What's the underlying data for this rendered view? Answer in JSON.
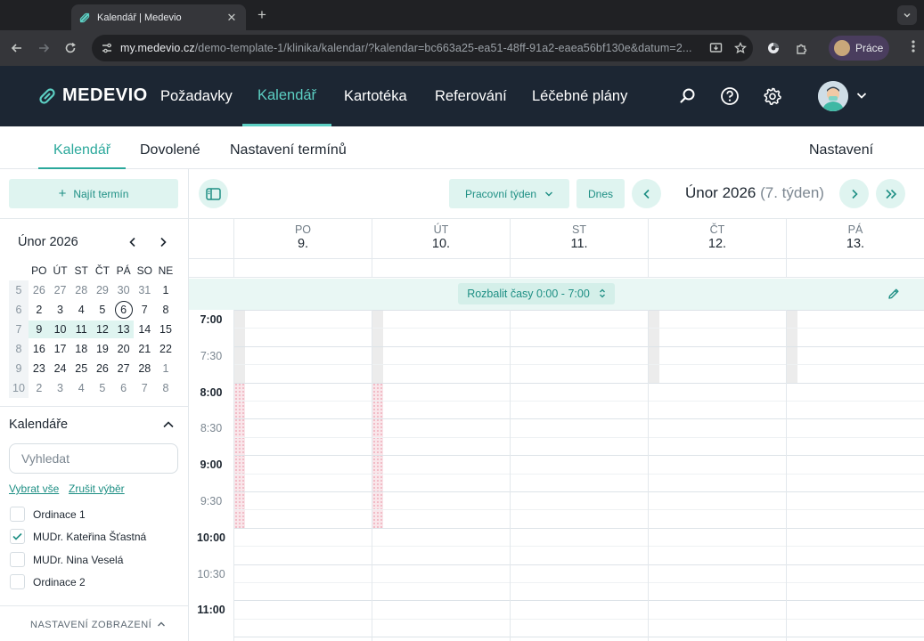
{
  "browser": {
    "tab_title": "Kalendář | Medevio",
    "url_host": "my.medevio.cz",
    "url_rest": "/demo-template-1/klinika/kalendar/?kalendar=bc663a25-ea51-48ff-91a2-eaea56bf130e&datum=2...",
    "profile_label": "Práce"
  },
  "app": {
    "logo_text": "MEDEVIO",
    "nav": [
      "Požadavky",
      "Kalendář",
      "Kartotéka",
      "Referování",
      "Léčebné plány"
    ],
    "active_nav": "Kalendář",
    "accent_color": "#5ccfc3",
    "header_bg": "#1c2633"
  },
  "subnav": {
    "tabs": [
      "Kalendář",
      "Dovolené",
      "Nastavení termínů"
    ],
    "settings": "Nastavení"
  },
  "sidebar": {
    "find_button": "Najít termín",
    "mini_calendar": {
      "title": "Únor 2026",
      "weekdays": [
        "PO",
        "ÚT",
        "ST",
        "ČT",
        "PÁ",
        "SO",
        "NE"
      ],
      "weeks": [
        {
          "wk": "5",
          "days": [
            "26",
            "27",
            "28",
            "29",
            "30",
            "31",
            "1"
          ]
        },
        {
          "wk": "6",
          "days": [
            "2",
            "3",
            "4",
            "5",
            "6",
            "7",
            "8"
          ]
        },
        {
          "wk": "7",
          "days": [
            "9",
            "10",
            "11",
            "12",
            "13",
            "14",
            "15"
          ]
        },
        {
          "wk": "8",
          "days": [
            "16",
            "17",
            "18",
            "19",
            "20",
            "21",
            "22"
          ]
        },
        {
          "wk": "9",
          "days": [
            "23",
            "24",
            "25",
            "26",
            "27",
            "28",
            "1"
          ]
        },
        {
          "wk": "10",
          "days": [
            "2",
            "3",
            "4",
            "5",
            "6",
            "7",
            "8"
          ]
        }
      ],
      "today": "6",
      "selected_week": "7"
    },
    "calendars_title": "Kalendáře",
    "search_placeholder": "Vyhledat",
    "select_all": "Vybrat vše",
    "clear_selection": "Zrušit výběr",
    "calendars": [
      {
        "label": "Ordinace 1",
        "checked": false
      },
      {
        "label": "MUDr. Kateřina Šťastná",
        "checked": true
      },
      {
        "label": "MUDr. Nina Veselá",
        "checked": false
      },
      {
        "label": "Ordinace 2",
        "checked": false
      }
    ],
    "display_settings": "NASTAVENÍ ZOBRAZENÍ"
  },
  "calendar": {
    "view_select": "Pracovní týden",
    "today_button": "Dnes",
    "month": "Únor 2026",
    "week": "(7. týden)",
    "days": [
      {
        "name": "PO",
        "date": "9."
      },
      {
        "name": "ÚT",
        "date": "10."
      },
      {
        "name": "ST",
        "date": "11."
      },
      {
        "name": "ČT",
        "date": "12."
      },
      {
        "name": "PÁ",
        "date": "13."
      }
    ],
    "expand_label": "Rozbalit časy 0:00 - 7:00",
    "times": [
      "7:00",
      "7:30",
      "8:00",
      "8:30",
      "9:00",
      "9:30",
      "10:00",
      "10:30",
      "11:00"
    ]
  }
}
